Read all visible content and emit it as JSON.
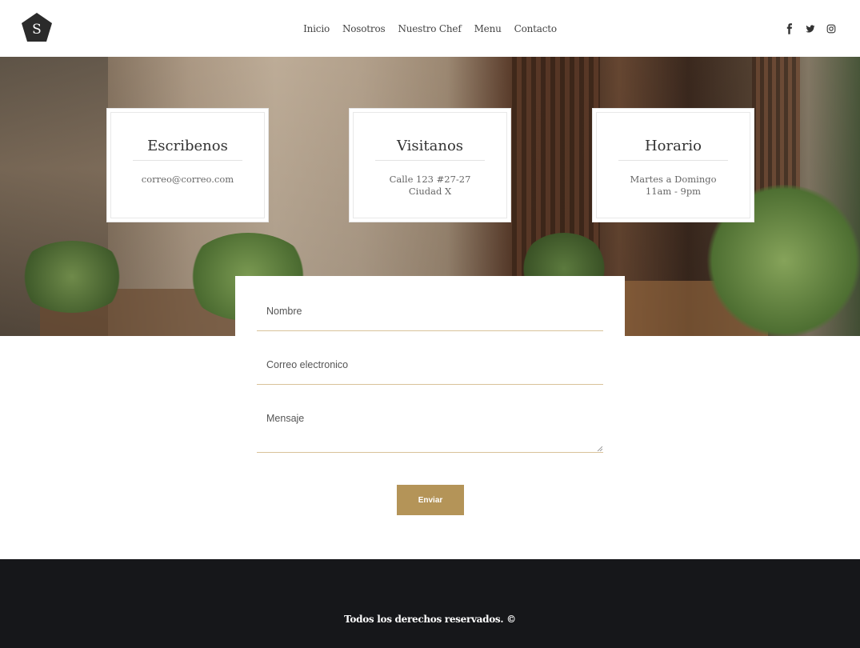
{
  "header": {
    "logo_letter": "S",
    "nav": [
      "Inicio",
      "Nosotros",
      "Nuestro Chef",
      "Menu",
      "Contacto"
    ],
    "social_icons": [
      "facebook-icon",
      "twitter-icon",
      "instagram-icon"
    ]
  },
  "cards": [
    {
      "title": "Escribenos",
      "text": "correo@correo.com"
    },
    {
      "title": "Visitanos",
      "text": "Calle 123 #27-27\nCiudad X"
    },
    {
      "title": "Horario",
      "text": "Martes a Domingo\n11am - 9pm"
    }
  ],
  "form": {
    "name_placeholder": "Nombre",
    "email_placeholder": "Correo electronico",
    "message_placeholder": "Mensaje",
    "submit_label": "Enviar"
  },
  "footer": {
    "copyright": "Todos los derechos reservados. ©"
  },
  "colors": {
    "accent": "#b49458",
    "field_underline": "#d9c29a",
    "footer_bg": "#16171a",
    "logo_bg": "#2b2b2b"
  }
}
